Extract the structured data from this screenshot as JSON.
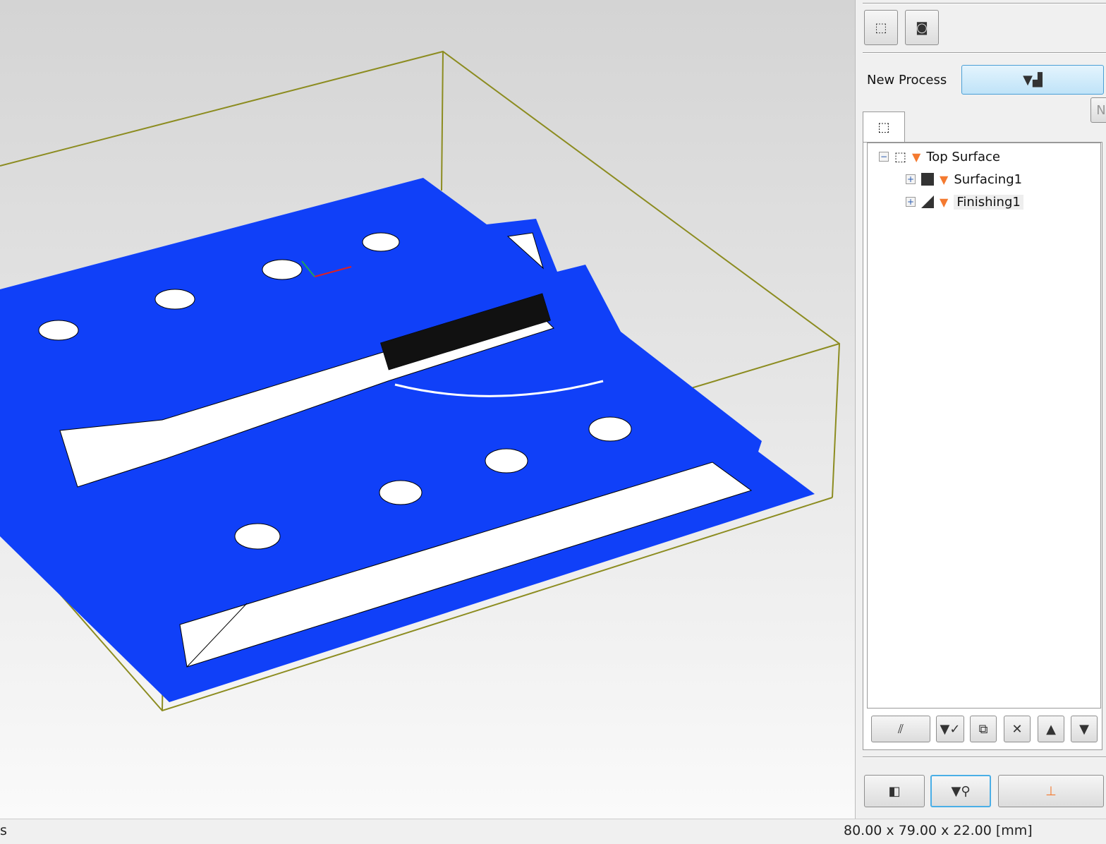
{
  "toolbar": {
    "view_box_icon": "wireframe-cube-icon",
    "stock_icon": "stock-ball-icon"
  },
  "new_process": {
    "label": "New Process",
    "button_icon": "tool-step-icon",
    "partial_tab": "N"
  },
  "tree": {
    "tab_icon": "part-cube-icon",
    "root": {
      "label": "Top Surface",
      "expanded": true
    },
    "children": [
      {
        "label": "Surfacing1",
        "type_icon": "square-icon"
      },
      {
        "label": "Finishing1",
        "type_icon": "triangle-icon",
        "selected": true
      }
    ]
  },
  "tree_buttons": [
    "toolpath-icon",
    "tool-check-icon",
    "copy-icon",
    "delete-icon",
    "move-up-icon",
    "move-down-icon"
  ],
  "bottom_buttons": [
    "stock-view-icon",
    "tool-inspect-icon",
    "simulate-cut-icon"
  ],
  "status": {
    "left": "s",
    "dimensions": "80.00 x 79.00 x 22.00 [mm]"
  },
  "colors": {
    "part": "#1040f8",
    "stock_box": "#8c8c20",
    "accent_orange": "#f47a30"
  }
}
